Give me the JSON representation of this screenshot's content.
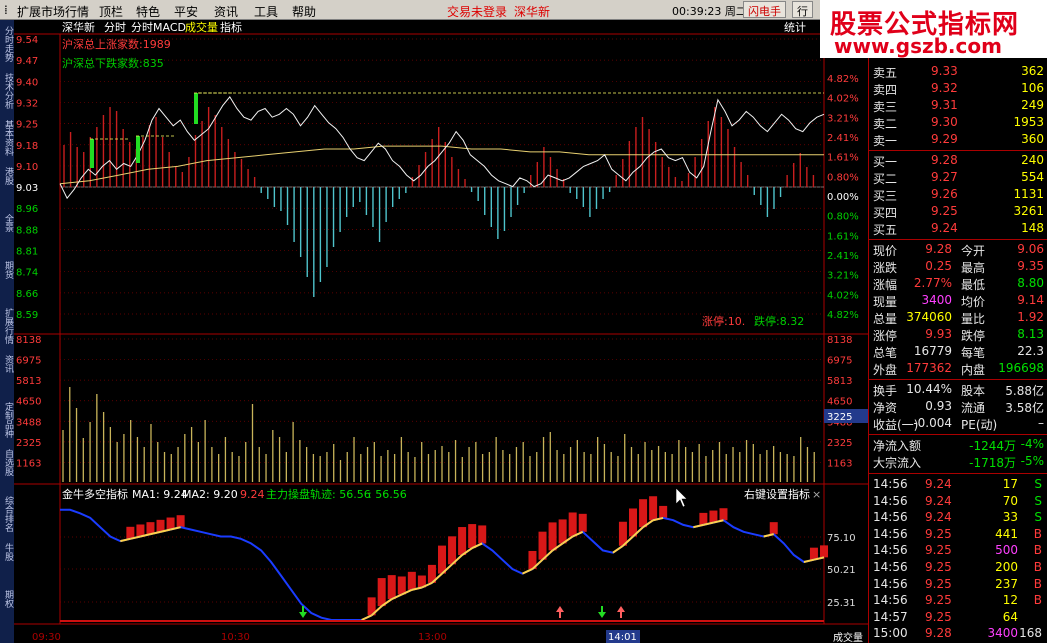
{
  "menubar": {
    "items": [
      "扩展市场行情",
      "顶栏",
      "特色",
      "平安",
      "资讯",
      "工具",
      "帮助"
    ],
    "login_status": "交易未登录",
    "stock_name": "深华新",
    "clock": "00:39:23",
    "clock_suffix": "周二",
    "btn_flash": "闪电手",
    "btn_row": "行"
  },
  "watermark": {
    "line1": "股票公式指标网",
    "line2": "www.gszb.com"
  },
  "left_tabs": [
    "分时走势",
    "技术分析",
    "基本资料",
    "港股",
    "全景",
    "期货",
    "扩展行情",
    "资讯",
    "定制品种",
    "自选股",
    "综合排名",
    "牛股",
    "期权"
  ],
  "intraday": {
    "header": {
      "name": "深华新",
      "tab1": "分时",
      "tab2": "分时MACD",
      "tab3": "成交量",
      "tab4": "指标",
      "stats": "统计"
    },
    "up_count_label": "沪深总上涨家数:1989",
    "down_count_label": "沪深总下跌家数:835",
    "price_ticks": [
      "9.54",
      "9.47",
      "9.40",
      "9.32",
      "9.25",
      "9.18",
      "9.10",
      "9.03",
      "8.96",
      "8.88",
      "8.81",
      "8.74",
      "8.66",
      "8.59"
    ],
    "pct_ticks": [
      "4.82%",
      "4.02%",
      "3.21%",
      "2.41%",
      "1.61%",
      "0.80%",
      "0.00%",
      "0.80%",
      "1.61%",
      "2.41%",
      "3.21%",
      "4.02%",
      "4.82%"
    ],
    "limit_up_label": "涨停:",
    "limit_up_value": "10.",
    "limit_down_label": "跌停:",
    "limit_down_value": "8.32",
    "base_price": 9.03,
    "vol_ticks": [
      "8138",
      "6975",
      "5813",
      "4650",
      "3488",
      "2325",
      "1163"
    ],
    "vol_current": "3225",
    "time_labels": [
      "09:30",
      "10:30",
      "13:00",
      "14:01",
      "成交量"
    ],
    "price_series": [
      9.04,
      8.99,
      9.02,
      9.06,
      9.09,
      9.07,
      9.1,
      9.12,
      9.09,
      9.11,
      9.1,
      9.14,
      9.19,
      9.26,
      9.3,
      9.27,
      9.24,
      9.26,
      9.22,
      9.19,
      9.21,
      9.23,
      9.27,
      9.31,
      9.34,
      9.3,
      9.27,
      9.26,
      9.29,
      9.3,
      9.27,
      9.28,
      9.3,
      9.28,
      9.24,
      9.27,
      9.31,
      9.28,
      9.25,
      9.23,
      9.2,
      9.16,
      9.13,
      9.12,
      9.15,
      9.18,
      9.16,
      9.12,
      9.1,
      9.07,
      9.05,
      9.07,
      9.1,
      9.12,
      9.15,
      9.18,
      9.22,
      9.19,
      9.14,
      9.12,
      9.1,
      9.07,
      9.05,
      9.04,
      9.03,
      9.06,
      9.05,
      9.03,
      9.04,
      9.07,
      9.06,
      9.05,
      9.06,
      9.08,
      9.1,
      9.11,
      9.12,
      9.14,
      9.09,
      9.07,
      9.05,
      9.08,
      9.1,
      9.13,
      9.15,
      9.16,
      9.13,
      9.12,
      9.13,
      9.08,
      9.06,
      9.1,
      9.22,
      9.33,
      9.29,
      9.24,
      9.26,
      9.29,
      9.27,
      9.24,
      9.22,
      9.25,
      9.28,
      9.26,
      9.23,
      9.22,
      9.25,
      9.27,
      9.28
    ],
    "avg_series": [
      9.04,
      9.05,
      9.07,
      9.09,
      9.1,
      9.12,
      9.13,
      9.14,
      9.15,
      9.16,
      9.16,
      9.17,
      9.17,
      9.17,
      9.16,
      9.16,
      9.15,
      9.15,
      9.14,
      9.14,
      9.14,
      9.14,
      9.14,
      9.14,
      9.14,
      9.14,
      9.14
    ],
    "buy_sell_bars": [
      42,
      55,
      40,
      35,
      50,
      60,
      72,
      80,
      76,
      58,
      45,
      38,
      50,
      62,
      70,
      50,
      35,
      20,
      15,
      30,
      52,
      66,
      80,
      72,
      60,
      48,
      35,
      28,
      18,
      10,
      -6,
      -12,
      -20,
      -24,
      -38,
      -55,
      -70,
      -90,
      -110,
      -95,
      -80,
      -60,
      -45,
      -30,
      -20,
      -15,
      -28,
      -40,
      -55,
      -35,
      -20,
      -12,
      -6,
      10,
      22,
      35,
      48,
      60,
      45,
      30,
      18,
      8,
      -5,
      -14,
      -28,
      -40,
      -52,
      -44,
      -30,
      -18,
      -6,
      12,
      25,
      40,
      30,
      18,
      8,
      -6,
      -12,
      -20,
      -30,
      -22,
      -12,
      -5,
      12,
      28,
      46,
      60,
      70,
      58,
      45,
      30,
      20,
      10,
      6,
      14,
      30,
      48,
      66,
      80,
      70,
      58,
      40,
      25,
      12,
      -8,
      -18,
      -30,
      -22,
      -10,
      12,
      24,
      34,
      20,
      12
    ],
    "volumes": [
      52,
      95,
      74,
      44,
      60,
      88,
      70,
      55,
      40,
      48,
      62,
      45,
      35,
      58,
      40,
      30,
      28,
      35,
      48,
      55,
      40,
      62,
      35,
      28,
      45,
      30,
      26,
      40,
      78,
      35,
      28,
      52,
      45,
      30,
      60,
      42,
      35,
      28,
      26,
      30,
      38,
      22,
      30,
      45,
      28,
      35,
      40,
      26,
      32,
      28,
      45,
      30,
      25,
      40,
      28,
      32,
      36,
      30,
      42,
      25,
      35,
      40,
      28,
      30,
      45,
      32,
      28,
      35,
      40,
      26,
      30,
      45,
      50,
      32,
      28,
      35,
      42,
      30,
      28,
      45,
      38,
      30,
      26,
      48,
      35,
      28,
      40,
      32,
      36,
      30,
      28,
      42,
      35,
      30,
      38,
      26,
      32,
      40,
      28,
      35,
      30,
      42,
      38,
      28,
      32,
      36,
      30,
      28,
      26,
      45,
      35,
      30
    ]
  },
  "indicator": {
    "name": "金牛多空指标",
    "ma1_label": "MA1: 9.24",
    "ma2_label": "MA2: 9.20",
    "price_label": "9.24",
    "main_label": "主力操盘轨迹: 56.56",
    "main_value": ": 56.56",
    "right_hint": "右键设置指标",
    "close": "×",
    "ticks": [
      "75.10",
      "50.21",
      "25.31"
    ],
    "line": [
      95,
      95,
      92,
      88,
      80,
      72,
      68,
      70,
      72,
      74,
      76,
      78,
      80,
      78,
      76,
      74,
      72,
      72,
      70,
      66,
      60,
      50,
      38,
      26,
      14,
      6,
      2,
      0,
      0,
      0,
      0,
      4,
      12,
      18,
      22,
      26,
      28,
      32,
      40,
      48,
      56,
      62,
      66,
      60,
      52,
      44,
      40,
      44,
      52,
      60,
      66,
      72,
      76,
      68,
      60,
      58,
      64,
      72,
      80,
      86,
      88,
      86,
      82,
      80,
      82,
      84,
      86,
      80,
      76,
      74,
      72,
      74,
      66,
      56,
      50,
      52,
      54
    ]
  },
  "quote": {
    "asks": [
      {
        "label": "卖五",
        "price": "9.33",
        "vol": "362"
      },
      {
        "label": "卖四",
        "price": "9.32",
        "vol": "106"
      },
      {
        "label": "卖三",
        "price": "9.31",
        "vol": "249"
      },
      {
        "label": "卖二",
        "price": "9.30",
        "vol": "1953"
      },
      {
        "label": "卖一",
        "price": "9.29",
        "vol": "360"
      }
    ],
    "bids": [
      {
        "label": "买一",
        "price": "9.28",
        "vol": "240"
      },
      {
        "label": "买二",
        "price": "9.27",
        "vol": "554"
      },
      {
        "label": "买三",
        "price": "9.26",
        "vol": "1131"
      },
      {
        "label": "买四",
        "price": "9.25",
        "vol": "3261"
      },
      {
        "label": "买五",
        "price": "9.24",
        "vol": "148"
      }
    ],
    "stats": [
      {
        "l1": "现价",
        "v1": "9.28",
        "c1": "red",
        "l2": "今开",
        "v2": "9.06",
        "c2": "red"
      },
      {
        "l1": "涨跌",
        "v1": "0.25",
        "c1": "red",
        "l2": "最高",
        "v2": "9.35",
        "c2": "red"
      },
      {
        "l1": "涨幅",
        "v1": "2.77%",
        "c1": "red",
        "l2": "最低",
        "v2": "8.80",
        "c2": "green"
      },
      {
        "l1": "现量",
        "v1": "3400",
        "c1": "mag",
        "l2": "均价",
        "v2": "9.14",
        "c2": "red"
      },
      {
        "l1": "总量",
        "v1": "374060",
        "c1": "yel",
        "l2": "量比",
        "v2": "1.92",
        "c2": "red"
      },
      {
        "l1": "涨停",
        "v1": "9.93",
        "c1": "red",
        "l2": "跌停",
        "v2": "8.13",
        "c2": "green"
      },
      {
        "l1": "总笔",
        "v1": "16779",
        "c1": "wht",
        "l2": "每笔",
        "v2": "22.3",
        "c2": "wht"
      },
      {
        "l1": "外盘",
        "v1": "177362",
        "c1": "red",
        "l2": "内盘",
        "v2": "196698",
        "c2": "green"
      }
    ],
    "fundamentals": [
      {
        "l1": "换手",
        "v1": "10.44%",
        "c1": "wht",
        "l2": "股本",
        "v2": "5.88亿",
        "c2": "wht"
      },
      {
        "l1": "净资",
        "v1": "0.93",
        "c1": "wht",
        "l2": "流通",
        "v2": "3.58亿",
        "c2": "wht"
      },
      {
        "l1": "收益(一)",
        "v1": "-0.004",
        "c1": "wht",
        "l2": "PE(动)",
        "v2": "–",
        "c2": "wht"
      }
    ],
    "flows": [
      {
        "label": "净流入额",
        "value": "-1244万",
        "pct": "-4%"
      },
      {
        "label": "大宗流入",
        "value": "-1718万",
        "pct": "-5%"
      }
    ],
    "ticks": [
      {
        "time": "14:56",
        "price": "9.24",
        "pc": "red",
        "vol": "17",
        "side": "S"
      },
      {
        "time": "14:56",
        "price": "9.24",
        "pc": "red",
        "vol": "70",
        "side": "S"
      },
      {
        "time": "14:56",
        "price": "9.24",
        "pc": "red",
        "vol": "33",
        "side": "S"
      },
      {
        "time": "14:56",
        "price": "9.25",
        "pc": "red",
        "vol": "441",
        "side": "B"
      },
      {
        "time": "14:56",
        "price": "9.25",
        "pc": "red",
        "vol": "500",
        "side": "B"
      },
      {
        "time": "14:56",
        "price": "9.25",
        "pc": "red",
        "vol": "200",
        "side": "B"
      },
      {
        "time": "14:56",
        "price": "9.25",
        "pc": "red",
        "vol": "237",
        "side": "B"
      },
      {
        "time": "14:56",
        "price": "9.25",
        "pc": "red",
        "vol": "12",
        "side": "B"
      },
      {
        "time": "14:57",
        "price": "9.25",
        "pc": "red",
        "vol": "64",
        "side": ""
      },
      {
        "time": "15:00",
        "price": "9.28",
        "pc": "red",
        "vol": "3400",
        "side": "168"
      }
    ]
  }
}
